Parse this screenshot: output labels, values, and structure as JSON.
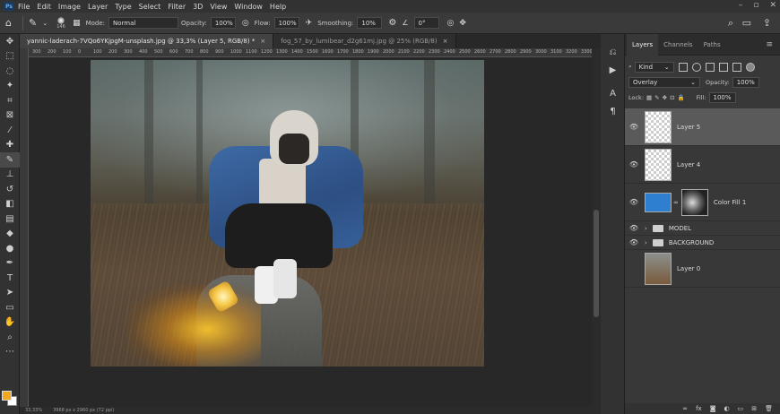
{
  "menubar": {
    "logo": "Ps",
    "items": [
      "File",
      "Edit",
      "Image",
      "Layer",
      "Type",
      "Select",
      "Filter",
      "3D",
      "View",
      "Window",
      "Help"
    ],
    "window_controls": [
      "–",
      "▫",
      "✕"
    ]
  },
  "options": {
    "brush_size": "146",
    "mode_label": "Mode:",
    "mode_value": "Normal",
    "opacity_label": "Opacity:",
    "opacity_value": "100%",
    "flow_label": "Flow:",
    "flow_value": "100%",
    "smoothing_label": "Smoothing:",
    "smoothing_value": "10%",
    "angle_value": "0°"
  },
  "tabs": [
    {
      "label": "yannic-laderach-7VQo6YKjpgM-unsplash.jpg @ 33,3% (Layer 5, RGB/8) *",
      "close": "×"
    },
    {
      "label": "fog_57_by_lumibear_d2g61mj.jpg @ 25% (RGB/8)",
      "close": "×"
    }
  ],
  "ruler": [
    "300",
    "200",
    "100",
    "0",
    "100",
    "200",
    "300",
    "400",
    "500",
    "600",
    "700",
    "800",
    "900",
    "1000",
    "1100",
    "1200",
    "1300",
    "1400",
    "1500",
    "1600",
    "1700",
    "1800",
    "1900",
    "2000",
    "2100",
    "2200",
    "2300",
    "2400",
    "2500",
    "2600",
    "2700",
    "2800",
    "2900",
    "3000",
    "3100",
    "3200",
    "3300"
  ],
  "status": {
    "zoom": "33,33%",
    "doc": "3968 px x 2960 px (72 ppi)"
  },
  "swatches": {
    "foreground": "#f0a81e",
    "background": "#ffffff"
  },
  "layers_panel": {
    "tabs": [
      "Layers",
      "Channels",
      "Paths"
    ],
    "kind_label": "Kind",
    "blend_mode": "Overlay",
    "opacity_label": "Opacity:",
    "opacity_value": "100%",
    "lock_label": "Lock:",
    "fill_label": "Fill:",
    "fill_value": "100%",
    "layers": [
      {
        "name": "Layer 5"
      },
      {
        "name": "Layer 4"
      },
      {
        "name": "Color Fill 1"
      },
      {
        "name": "MODEL"
      },
      {
        "name": "BACKGROUND"
      },
      {
        "name": "Layer 0"
      }
    ]
  }
}
